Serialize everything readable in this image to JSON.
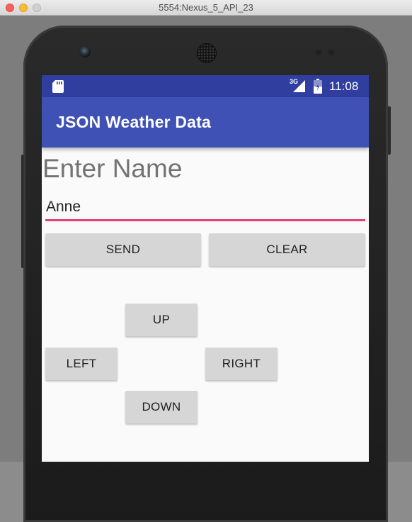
{
  "window": {
    "title": "5554:Nexus_5_API_23"
  },
  "status_bar": {
    "network_type": "3G",
    "time": "11:08",
    "icons": [
      "sd-card-icon",
      "signal-icon",
      "battery-icon"
    ]
  },
  "app_bar": {
    "title": "JSON Weather Data"
  },
  "main": {
    "prompt_label": "Enter Name",
    "name_input": {
      "value": "Anne"
    },
    "buttons": {
      "send": "SEND",
      "clear": "CLEAR",
      "up": "UP",
      "left": "LEFT",
      "right": "RIGHT",
      "down": "DOWN"
    }
  },
  "colors": {
    "status_bar": "#303f9f",
    "app_bar": "#3f51b5",
    "input_underline": "#e5407a",
    "button": "#d6d6d6",
    "screen_background": "#fafafa"
  }
}
